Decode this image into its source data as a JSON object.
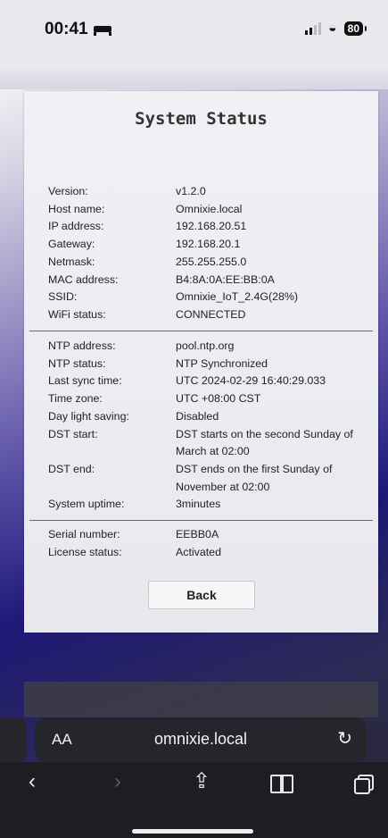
{
  "status_bar": {
    "time": "00:41",
    "battery": "80"
  },
  "card": {
    "title": "System Status",
    "network": [
      {
        "label": "Version:",
        "value": "v1.2.0"
      },
      {
        "label": "Host name:",
        "value": "Omnixie.local"
      },
      {
        "label": "IP address:",
        "value": "192.168.20.51"
      },
      {
        "label": "Gateway:",
        "value": "192.168.20.1"
      },
      {
        "label": "Netmask:",
        "value": "255.255.255.0"
      },
      {
        "label": "MAC address:",
        "value": "B4:8A:0A:EE:BB:0A"
      },
      {
        "label": "SSID:",
        "value": "Omnixie_IoT_2.4G(28%)"
      },
      {
        "label": "WiFi status:",
        "value": "CONNECTED"
      }
    ],
    "time": [
      {
        "label": "NTP address:",
        "value": "pool.ntp.org"
      },
      {
        "label": "NTP status:",
        "value": "NTP Synchronized"
      },
      {
        "label": "Last sync time:",
        "value": "UTC 2024-02-29 16:40:29.033"
      },
      {
        "label": "Time zone:",
        "value": "UTC +08:00 CST"
      },
      {
        "label": "Day light saving:",
        "value": "Disabled"
      },
      {
        "label": "DST start:",
        "value": "DST starts on the second Sunday of March at 02:00"
      },
      {
        "label": "DST end:",
        "value": "DST ends on the first Sunday of November at 02:00"
      },
      {
        "label": "System uptime:",
        "value": "3minutes"
      }
    ],
    "license": [
      {
        "label": "Serial number:",
        "value": "EEBB0A"
      },
      {
        "label": "License status:",
        "value": "Activated"
      }
    ],
    "back_label": "Back"
  },
  "browser": {
    "aa_label": "AA",
    "url": "omnixie.local"
  }
}
